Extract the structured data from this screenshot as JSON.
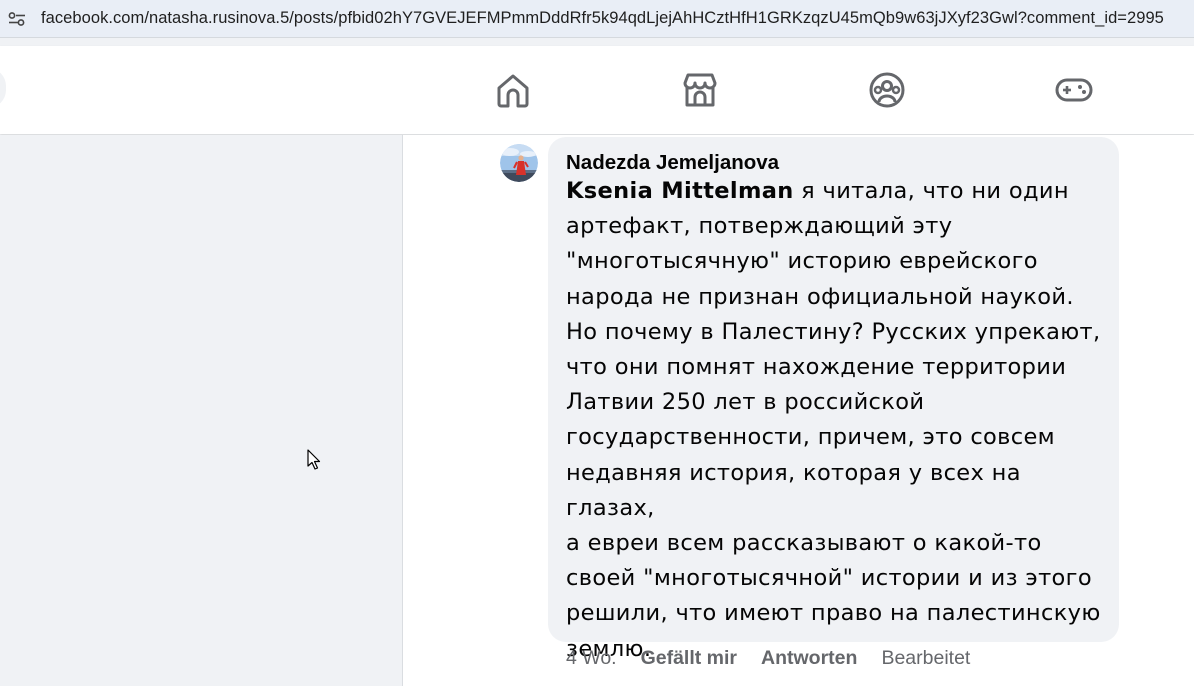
{
  "browser": {
    "url_host": "facebook.com",
    "url_path": "/natasha.rusinova.5/posts/pfbid02hY7GVEJEFMPmmDddRfr5k94qdLjejAhHCztHfH1GRKzqzU45mQb9w63jJXyf23Gwl?comment_id=2995"
  },
  "nav": {
    "icons": [
      "home-icon",
      "marketplace-icon",
      "groups-icon",
      "gaming-icon"
    ]
  },
  "comment": {
    "author": "Nadezda Jemeljanova",
    "mention": "Ksenia Mittelman",
    "text_lines": [
      " я читала, что ни один",
      "артефакт, потверждающий эту",
      "\"многотысячную\" историю еврейского",
      "народа не признан официальной наукой.",
      "Но почему в Палестину? Русских упрекают,",
      "что они помнят нахождение территории",
      "Латвии 250 лет в российской",
      "государственности, причем, это совсем",
      "недавняя история, которая у всех на глазах,",
      "а евреи всем рассказывают о какой-то",
      "своей \"многотысячной\" истории и из этого",
      "решили, что имеют право на палестинскую",
      "землю."
    ],
    "time": "4 Wo.",
    "like_label": "Gefällt mir",
    "reply_label": "Antworten",
    "edited_label": "Bearbeitet"
  },
  "colors": {
    "bubble_bg": "#f0f2f5",
    "page_bg": "#f0f2f5",
    "meta_text": "#65676b",
    "icon_color": "#65676b"
  }
}
